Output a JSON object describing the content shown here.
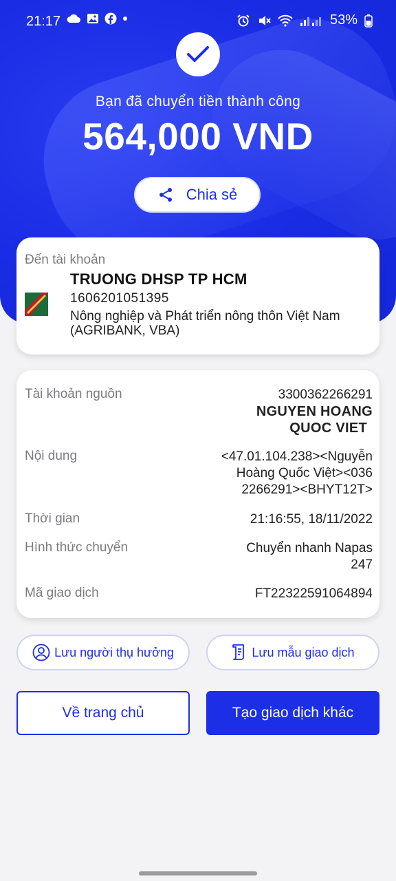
{
  "status_bar": {
    "time": "21:17",
    "battery": "53%"
  },
  "hero": {
    "message": "Bạn đã chuyển tiền thành công",
    "amount": "564,000 VND",
    "share_label": "Chia sẻ"
  },
  "destination": {
    "label": "Đến tài khoản",
    "name": "TRUONG DHSP TP HCM",
    "account": "1606201051395",
    "bank": "Nông nghiệp và Phát triển nông thôn Việt Nam (AGRIBANK, VBA)"
  },
  "details": {
    "source_label": "Tài khoản nguồn",
    "source_account": "3300362266291",
    "source_name_1": "NGUYEN HOANG",
    "source_name_2": "QUOC VIET",
    "content_label": "Nội dung",
    "content_1": "<47.01.104.238><Nguyễn",
    "content_2": "Hoàng Quốc Việt><036",
    "content_3": "2266291><BHYT12T>",
    "time_label": "Thời gian",
    "time_value": "21:16:55, 18/11/2022",
    "method_label": "Hình thức chuyển",
    "method_1": "Chuyển nhanh Napas",
    "method_2": "247",
    "txn_label": "Mã giao dịch",
    "txn_value": "FT22322591064894"
  },
  "actions": {
    "save_beneficiary": "Lưu người thụ hưởng",
    "save_template": "Lưu mẫu giao dịch",
    "home": "Về trang chủ",
    "new_transaction": "Tạo giao dịch khác"
  },
  "colors": {
    "primary": "#1c2ee6",
    "background": "#f3f3f5"
  }
}
